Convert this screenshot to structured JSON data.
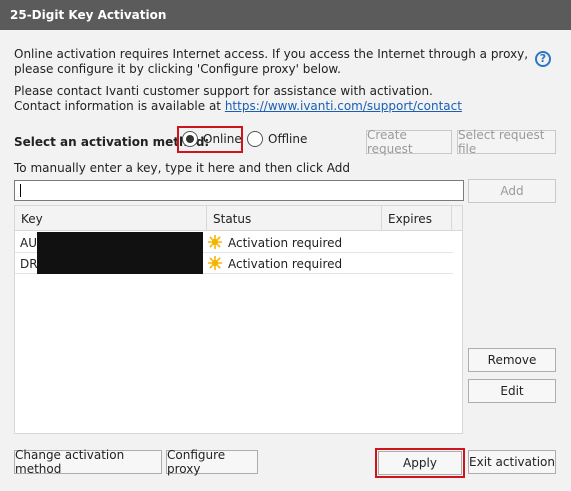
{
  "window": {
    "title": "25-Digit Key Activation"
  },
  "intro": {
    "line1": "Online activation requires Internet access. If you access the Internet through a proxy,",
    "line2": "please configure it by clicking 'Configure proxy' below.",
    "line3": "Please contact Ivanti customer support for assistance with activation.",
    "line4_prefix": "Contact information is available at ",
    "link": "https://www.ivanti.com/support/contact"
  },
  "help": {
    "glyph": "?"
  },
  "method": {
    "label": "Select an activation method:",
    "online": "Online",
    "offline": "Offline",
    "selected": "Online"
  },
  "buttons": {
    "create_request": "Create request",
    "select_request_file": "Select request file",
    "add": "Add",
    "remove": "Remove",
    "edit": "Edit",
    "change_method": "Change activation method",
    "configure_proxy": "Configure proxy",
    "apply": "Apply",
    "exit": "Exit activation"
  },
  "manual": {
    "instruction": "To manually enter a key, type it here and then click Add",
    "value": ""
  },
  "table": {
    "columns": [
      "Key",
      "Status",
      "Expires"
    ],
    "rows": [
      {
        "key_prefix": "AU",
        "status": "Activation required",
        "expires": ""
      },
      {
        "key_prefix": "DR",
        "status": "Activation required",
        "expires": ""
      }
    ]
  },
  "colors": {
    "titlebar": "#5b5b5b",
    "panel": "#f2f2f2",
    "highlight": "#d0141e",
    "link": "#1a5fb4",
    "warning_icon": "#f5b400"
  }
}
